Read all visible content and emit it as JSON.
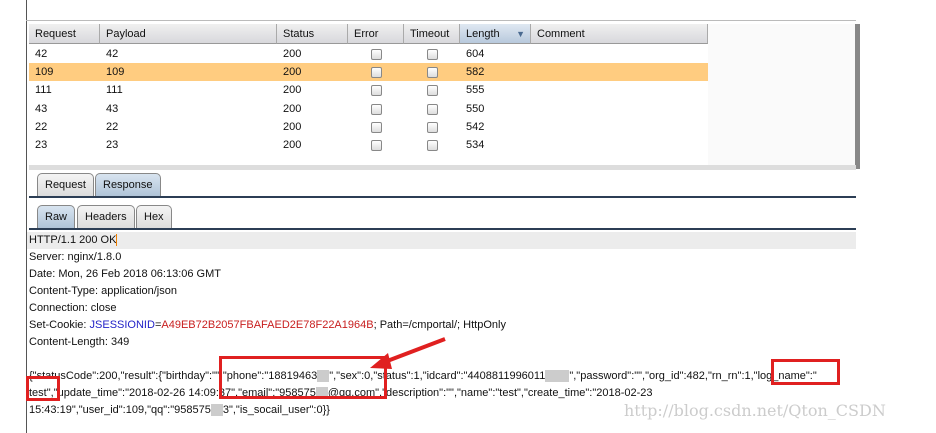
{
  "table": {
    "columns": [
      "Request",
      "Payload",
      "Status",
      "Error",
      "Timeout",
      "Length",
      "Comment"
    ],
    "sorted_column": "Length",
    "rows": [
      {
        "request": "42",
        "payload": "42",
        "status": "200",
        "length": "604",
        "selected": false
      },
      {
        "request": "109",
        "payload": "109",
        "status": "200",
        "length": "582",
        "selected": true
      },
      {
        "request": "111",
        "payload": "111",
        "status": "200",
        "length": "555",
        "selected": false
      },
      {
        "request": "43",
        "payload": "43",
        "status": "200",
        "length": "550",
        "selected": false
      },
      {
        "request": "22",
        "payload": "22",
        "status": "200",
        "length": "542",
        "selected": false
      },
      {
        "request": "23",
        "payload": "23",
        "status": "200",
        "length": "534",
        "selected": false
      }
    ]
  },
  "tabs": [
    "Request",
    "Response"
  ],
  "subtabs": [
    "Raw",
    "Headers",
    "Hex"
  ],
  "response": {
    "status_line": "HTTP/1.1 200 OK",
    "server": "Server: nginx/1.8.0",
    "date": "Date: Mon, 26 Feb 2018 06:13:06 GMT",
    "content_type": "Content-Type: application/json",
    "connection": "Connection: close",
    "cookie_prefix": "Set-Cookie: ",
    "cookie_name": "JSESSIONID",
    "cookie_eq": "=",
    "cookie_value": "A49EB72B2057FBAFAED2E78F22A1964B",
    "cookie_suffix": "; Path=/cmportal/; HttpOnly",
    "content_length": "Content-Length: 349",
    "json_line1a": "{\"statusCode\":200,\"result\":{\"birthday\":\"\",\"phone\":\"18819463",
    "json_line1b": "\",\"sex\":0,\"status\":1,\"idcard\":\"4408811996011",
    "json_line1c": "\",\"password\":\"\",\"org_id\":482,\"rn_rn\":1,\"log_name\":\"",
    "json_line2a": "test\",\"update_time\":\"2018-02-26 14:09:37\",\"email\":\"958575",
    "json_line2b": "@qq.com\",\"description\":\"\",\"name\":\"test\",\"create_time\":\"2018-02-23",
    "json_line3a": "15:43:19\",\"user_id\":109,\"qq\":\"958575",
    "json_line3b": "3\",\"is_socail_user\":0}}"
  },
  "watermark": "http://blog.csdn.net/Qton_CSDN"
}
